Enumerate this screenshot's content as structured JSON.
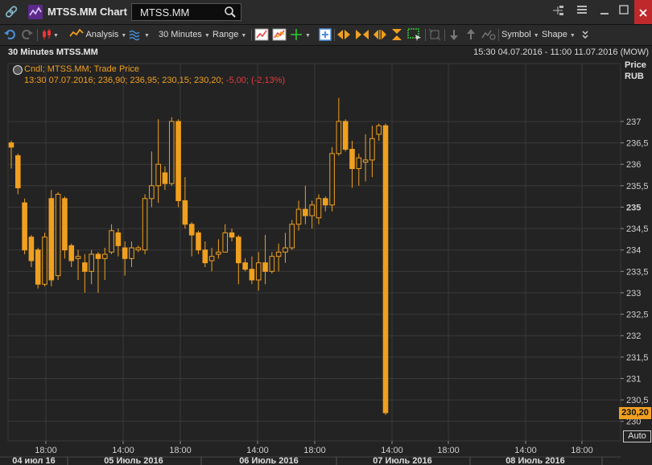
{
  "window": {
    "app_title": "MTSS.MM Chart",
    "symbol": "MTSS.MM",
    "colors": {
      "titlebar": "#2b2b2b",
      "close": "#c0292b",
      "accent": "#f0a020",
      "negative": "#e43c3c",
      "background": "#232323"
    }
  },
  "toolbar": {
    "analysis_label": "Analysis",
    "interval_label": "30 Minutes",
    "range_label": "Range",
    "symbol_label": "Symbol",
    "shape_label": "Shape"
  },
  "chart_header": {
    "title": "30 Minutes MTSS.MM",
    "date_range": "15:30 04.07.2016 - 11:00 11.07.2016 (MOW)"
  },
  "legend": {
    "series_label": "Cndl; MTSS.MM; Trade Price",
    "ohlc_text": "13:30 07.07.2016; 236,90; 236,95; 230,15; 230,20;",
    "change_text": "-5,00; (-2,13%)"
  },
  "price_axis": {
    "header_1": "Price",
    "header_2": "RUB",
    "last_price_label": "230,20",
    "auto_label": "Auto"
  },
  "chart_data": {
    "type": "candlestick",
    "title": "30 Minutes MTSS.MM",
    "ylabel": "Price RUB",
    "ylim": [
      229.75,
      237.45
    ],
    "y_ticks": [
      230,
      230.5,
      231,
      231.5,
      232,
      232.5,
      233,
      233.5,
      234,
      234.5,
      235,
      235.5,
      236,
      236.5,
      237
    ],
    "y_tick_labels": [
      "230",
      "230,5",
      "231",
      "231,5",
      "232",
      "232,5",
      "233",
      "233,5",
      "234",
      "234,5",
      "235",
      "235,5",
      "236",
      "236,5",
      "237"
    ],
    "x_time_labels": [
      "18:00",
      "14:00",
      "18:00",
      "14:00",
      "18:00",
      "14:00",
      "18:00",
      "14:00",
      "18:00"
    ],
    "x_date_labels": [
      "04 июл 16",
      "05 Июль 2016",
      "06 Июль 2016",
      "07 Июль 2016",
      "08 Июль 2016"
    ],
    "last_price": 230.2,
    "candles": [
      {
        "o": 236.5,
        "h": 236.55,
        "l": 235.9,
        "c": 236.4
      },
      {
        "o": 236.2,
        "h": 236.25,
        "l": 235.3,
        "c": 235.45
      },
      {
        "o": 235.1,
        "h": 235.2,
        "l": 233.9,
        "c": 234.0
      },
      {
        "o": 234.3,
        "h": 234.35,
        "l": 233.6,
        "c": 233.75
      },
      {
        "o": 234.0,
        "h": 234.05,
        "l": 233.1,
        "c": 233.2
      },
      {
        "o": 233.2,
        "h": 234.4,
        "l": 233.15,
        "c": 234.3
      },
      {
        "o": 235.2,
        "h": 235.4,
        "l": 233.15,
        "c": 233.3
      },
      {
        "o": 233.4,
        "h": 235.35,
        "l": 233.3,
        "c": 235.3
      },
      {
        "o": 235.2,
        "h": 235.25,
        "l": 233.8,
        "c": 234.0
      },
      {
        "o": 234.1,
        "h": 234.15,
        "l": 233.6,
        "c": 233.75
      },
      {
        "o": 233.8,
        "h": 234.0,
        "l": 233.3,
        "c": 233.85
      },
      {
        "o": 233.7,
        "h": 233.9,
        "l": 233.0,
        "c": 233.5
      },
      {
        "o": 233.5,
        "h": 234.0,
        "l": 233.2,
        "c": 233.9
      },
      {
        "o": 233.9,
        "h": 233.95,
        "l": 233.0,
        "c": 233.8
      },
      {
        "o": 233.8,
        "h": 234.05,
        "l": 233.3,
        "c": 233.9
      },
      {
        "o": 233.95,
        "h": 234.6,
        "l": 233.9,
        "c": 234.45
      },
      {
        "o": 234.4,
        "h": 234.5,
        "l": 233.85,
        "c": 234.1
      },
      {
        "o": 234.05,
        "h": 234.2,
        "l": 233.4,
        "c": 233.8
      },
      {
        "o": 233.8,
        "h": 234.2,
        "l": 233.6,
        "c": 234.05
      },
      {
        "o": 234.0,
        "h": 234.1,
        "l": 233.95,
        "c": 234.05
      },
      {
        "o": 234.0,
        "h": 235.3,
        "l": 233.9,
        "c": 235.2
      },
      {
        "o": 235.2,
        "h": 236.3,
        "l": 235.0,
        "c": 235.5
      },
      {
        "o": 235.5,
        "h": 237.05,
        "l": 235.1,
        "c": 236.0
      },
      {
        "o": 235.8,
        "h": 235.95,
        "l": 235.4,
        "c": 235.55
      },
      {
        "o": 235.55,
        "h": 237.1,
        "l": 235.5,
        "c": 237.0
      },
      {
        "o": 237.0,
        "h": 237.05,
        "l": 235.0,
        "c": 235.15
      },
      {
        "o": 235.15,
        "h": 235.7,
        "l": 234.5,
        "c": 234.6
      },
      {
        "o": 234.6,
        "h": 234.65,
        "l": 233.85,
        "c": 234.35
      },
      {
        "o": 234.4,
        "h": 234.45,
        "l": 233.9,
        "c": 234.0
      },
      {
        "o": 234.0,
        "h": 234.2,
        "l": 233.6,
        "c": 233.7
      },
      {
        "o": 233.75,
        "h": 234.05,
        "l": 233.5,
        "c": 233.85
      },
      {
        "o": 233.9,
        "h": 234.25,
        "l": 233.8,
        "c": 233.95
      },
      {
        "o": 233.95,
        "h": 234.6,
        "l": 233.95,
        "c": 234.4
      },
      {
        "o": 234.4,
        "h": 234.5,
        "l": 234.2,
        "c": 234.3
      },
      {
        "o": 234.3,
        "h": 234.35,
        "l": 233.2,
        "c": 233.7
      },
      {
        "o": 233.7,
        "h": 233.8,
        "l": 233.5,
        "c": 233.55
      },
      {
        "o": 233.55,
        "h": 233.85,
        "l": 233.2,
        "c": 233.3
      },
      {
        "o": 233.3,
        "h": 233.95,
        "l": 233.05,
        "c": 233.7
      },
      {
        "o": 233.7,
        "h": 234.35,
        "l": 233.2,
        "c": 233.5
      },
      {
        "o": 233.5,
        "h": 233.95,
        "l": 233.45,
        "c": 233.85
      },
      {
        "o": 233.85,
        "h": 234.15,
        "l": 233.5,
        "c": 233.95
      },
      {
        "o": 233.95,
        "h": 234.4,
        "l": 233.7,
        "c": 234.05
      },
      {
        "o": 234.05,
        "h": 234.7,
        "l": 234.0,
        "c": 234.6
      },
      {
        "o": 234.6,
        "h": 235.15,
        "l": 234.45,
        "c": 234.95
      },
      {
        "o": 234.95,
        "h": 235.5,
        "l": 234.6,
        "c": 234.8
      },
      {
        "o": 234.8,
        "h": 235.15,
        "l": 234.5,
        "c": 235.05
      },
      {
        "o": 234.75,
        "h": 235.3,
        "l": 234.6,
        "c": 235.2
      },
      {
        "o": 235.2,
        "h": 235.25,
        "l": 234.9,
        "c": 235.05
      },
      {
        "o": 235.05,
        "h": 236.4,
        "l": 234.9,
        "c": 236.25
      },
      {
        "o": 236.25,
        "h": 237.55,
        "l": 236.2,
        "c": 237.0
      },
      {
        "o": 237.0,
        "h": 237.05,
        "l": 236.3,
        "c": 236.35
      },
      {
        "o": 236.35,
        "h": 236.55,
        "l": 235.45,
        "c": 235.9
      },
      {
        "o": 235.9,
        "h": 236.25,
        "l": 235.5,
        "c": 236.15
      },
      {
        "o": 236.05,
        "h": 236.7,
        "l": 235.6,
        "c": 236.1
      },
      {
        "o": 236.1,
        "h": 236.9,
        "l": 235.7,
        "c": 236.6
      },
      {
        "o": 236.7,
        "h": 236.95,
        "l": 236.55,
        "c": 236.9
      },
      {
        "o": 236.9,
        "h": 236.95,
        "l": 230.15,
        "c": 230.2
      }
    ]
  }
}
